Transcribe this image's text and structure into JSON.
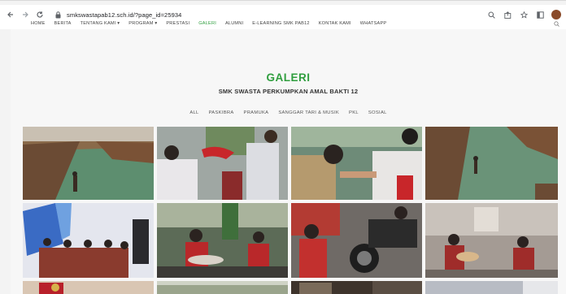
{
  "browser": {
    "url": "smkswastapab12.sch.id/?page_id=25934"
  },
  "nav": {
    "items": [
      "HOME",
      "BERITA",
      "TENTANG KAMI ▾",
      "PROGRAM ▾",
      "PRESTASI",
      "GALERI",
      "ALUMNI",
      "E-LEARNING SMK PAB12",
      "KONTAK KAMI",
      "WhatsApp"
    ],
    "active_index": 5,
    "active_color": "#2f9e3e"
  },
  "gallery": {
    "title": "GALERI",
    "subtitle": "SMK SWASTA PERKUMPKAN AMAL BAKTI 12",
    "filters": [
      "All",
      "PASKIBRA",
      "PRAMUKA",
      "SANGGAR TARI & MUSIK",
      "PKL",
      "SOSIAL"
    ]
  },
  "colors": {
    "accent": "#2f9e3e",
    "page_bg": "#f7f7f7"
  },
  "icons": [
    "back-icon",
    "forward-icon",
    "reload-icon",
    "lock-icon",
    "search-icon",
    "share-icon",
    "star-icon",
    "window-icon",
    "profile-avatar"
  ]
}
